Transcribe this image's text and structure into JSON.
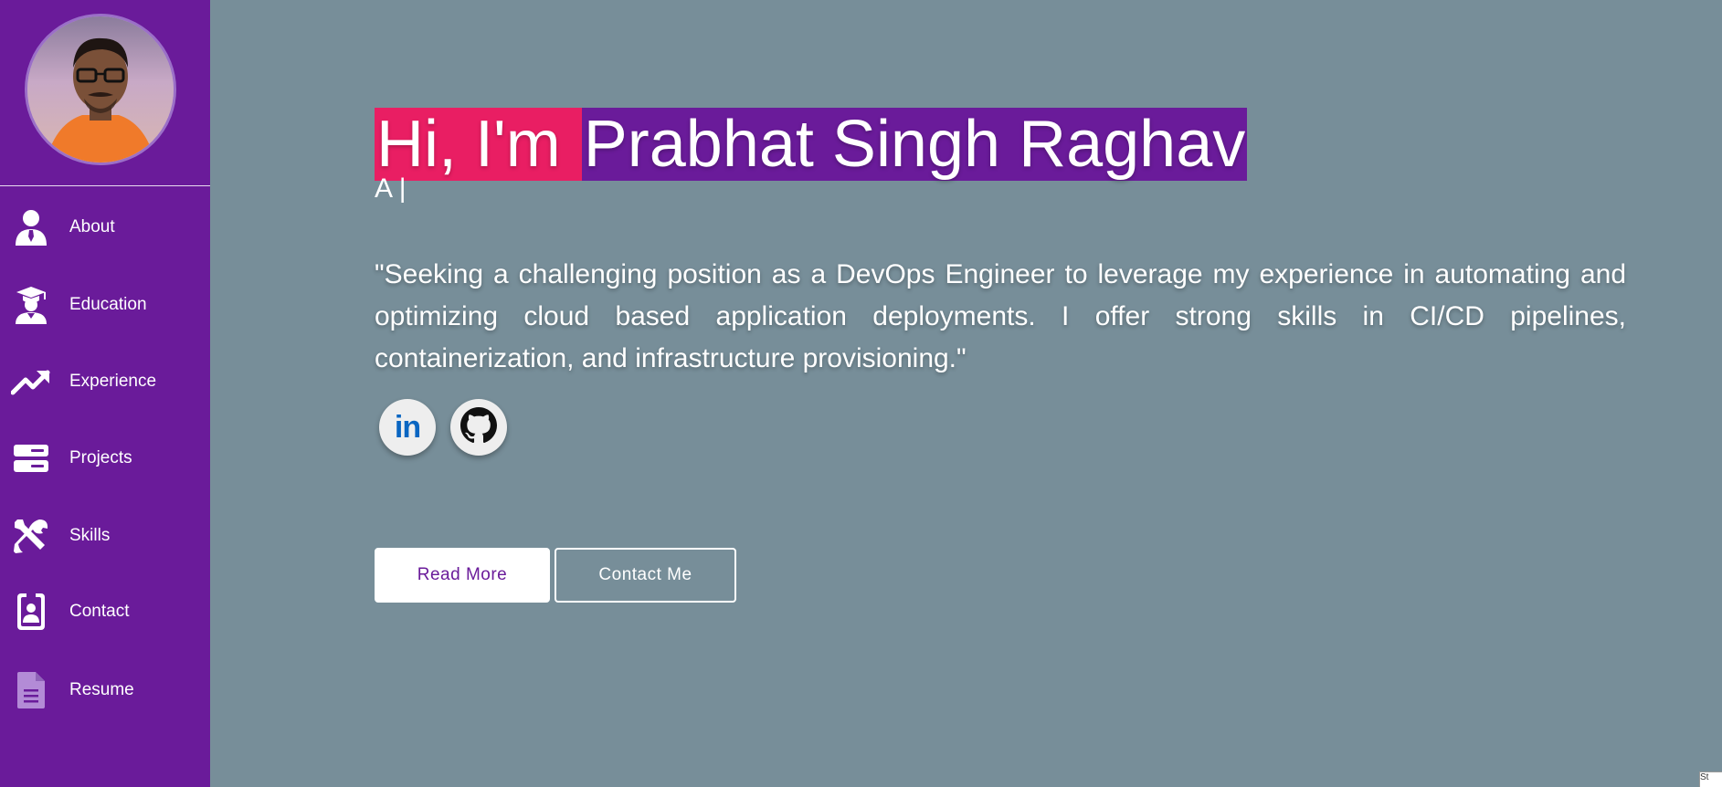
{
  "sidebar": {
    "avatar_alt": "profile photo",
    "items": [
      {
        "label": "About",
        "icon": "user-tie-icon"
      },
      {
        "label": "Education",
        "icon": "graduation-user-icon"
      },
      {
        "label": "Experience",
        "icon": "trending-up-icon"
      },
      {
        "label": "Projects",
        "icon": "server-icon"
      },
      {
        "label": "Skills",
        "icon": "tools-icon"
      },
      {
        "label": "Contact",
        "icon": "id-badge-icon"
      },
      {
        "label": "Resume",
        "icon": "document-icon"
      }
    ]
  },
  "hero": {
    "greeting": "Hi, I'm ",
    "name": "Prabhat Singh Raghav",
    "typed_text": "A |",
    "objective": "\"Seeking a challenging position as a DevOps Engineer to leverage my experience in automating and optimizing cloud based application deployments. I offer strong skills in CI/CD pipelines, containerization, and infrastructure provisioning.\""
  },
  "social": [
    {
      "name": "linkedin",
      "label": "in",
      "icon": "linkedin-icon"
    },
    {
      "name": "github",
      "icon": "github-icon"
    }
  ],
  "buttons": {
    "read_more": "Read More",
    "contact_me": "Contact Me"
  },
  "corner": {
    "text": "St"
  },
  "colors": {
    "sidebar_bg": "#6a1b9a",
    "page_bg": "#778e99",
    "greeting_highlight": "#e91e63",
    "name_highlight": "#6a1b9a",
    "linkedin_blue": "#0a66c2",
    "resume_icon": "#b38bd6"
  }
}
